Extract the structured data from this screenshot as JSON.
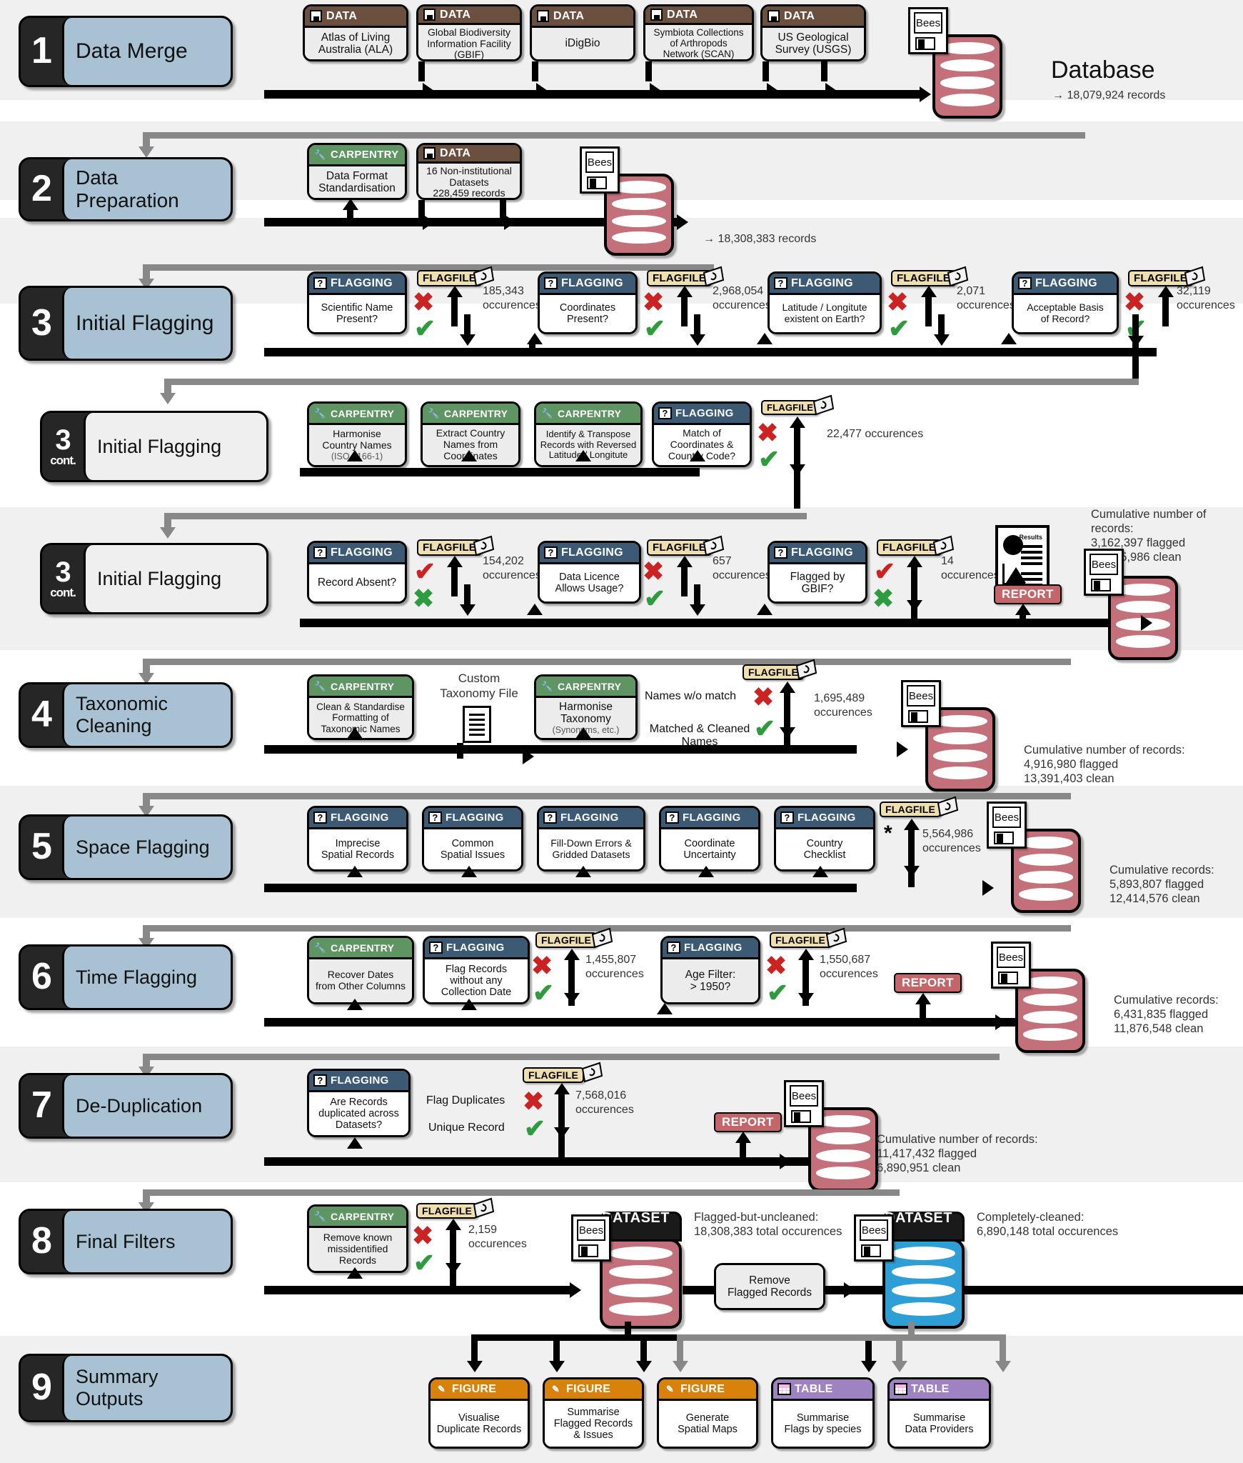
{
  "stages": [
    {
      "num": "1",
      "cont": "",
      "title": "Data Merge"
    },
    {
      "num": "2",
      "cont": "",
      "title": "Data Preparation"
    },
    {
      "num": "3",
      "cont": "",
      "title": "Initial Flagging"
    },
    {
      "num": "3",
      "cont": "cont.",
      "title": "Initial Flagging"
    },
    {
      "num": "3",
      "cont": "cont.",
      "title": "Initial Flagging"
    },
    {
      "num": "4",
      "cont": "",
      "title": "Taxonomic Cleaning"
    },
    {
      "num": "5",
      "cont": "",
      "title": "Space Flagging"
    },
    {
      "num": "6",
      "cont": "",
      "title": "Time Flagging"
    },
    {
      "num": "7",
      "cont": "",
      "title": "De-Duplication"
    },
    {
      "num": "8",
      "cont": "",
      "title": "Final Filters"
    },
    {
      "num": "9",
      "cont": "",
      "title": "Summary Outputs"
    }
  ],
  "headers": {
    "data": "DATA",
    "carpentry": "CARPENTRY",
    "flagging": "FLAGGING",
    "figure": "FIGURE",
    "table": "TABLE",
    "flagfile": "FLAGFILE",
    "report": "REPORT"
  },
  "stage1": {
    "sources": [
      {
        "head": "DATA",
        "line1": "Atlas of Living",
        "line2": "Australia (ALA)",
        "line3": ""
      },
      {
        "head": "DATA",
        "line1": "Global Biodiversity",
        "line2": "Information Facility",
        "line3": "(GBIF)"
      },
      {
        "head": "DATA",
        "line1": "iDigBio",
        "line2": "",
        "line3": ""
      },
      {
        "head": "DATA",
        "line1": "Symbiota Collections",
        "line2": "of Arthropods",
        "line3": "Network (SCAN)"
      },
      {
        "head": "DATA",
        "line1": "US Geological",
        "line2": "Survey (USGS)",
        "line3": ""
      }
    ],
    "db_label": "Bees",
    "db_title": "Database",
    "db_records": "→ 18,079,924 records"
  },
  "stage2": {
    "carpentry": {
      "line1": "Data Format",
      "line2": "Standardisation"
    },
    "data": {
      "line1": "16 Non-institutional",
      "line2": "Datasets",
      "line3": "228,459 records"
    },
    "db_label": "Bees",
    "records": "→ 18,308,383 records"
  },
  "stage3a": {
    "checks": [
      {
        "q1": "Scientific Name",
        "q2": "Present?",
        "count": "185,343",
        "unit": "occurences",
        "top": "x-red",
        "bottom": "ck-green"
      },
      {
        "q1": "Coordinates",
        "q2": "Present?",
        "count": "2,968,054",
        "unit": "occurences",
        "top": "x-red",
        "bottom": "ck-green"
      },
      {
        "q1": "Latitude / Longitute",
        "q2": "existent on Earth?",
        "count": "2,071",
        "unit": "occurences",
        "top": "x-red",
        "bottom": "ck-green"
      },
      {
        "q1": "Acceptable Basis",
        "q2": "of Record?",
        "count": "32,119",
        "unit": "occurences",
        "top": "x-red",
        "bottom": "ck-green"
      }
    ]
  },
  "stage3b": {
    "carpentry": [
      {
        "l1": "Harmonise",
        "l2": "Country Names",
        "sub": "(ISO 3166-1)"
      },
      {
        "l1": "Extract Country",
        "l2": "Names from",
        "l3": "Coordinates",
        "sub": ""
      },
      {
        "l1": "Identify & Transpose",
        "l2": "Records with Reversed",
        "l3": "Latitude / Longitute",
        "sub": ""
      }
    ],
    "flag": {
      "q1": "Match of",
      "q2": "Coordinates &",
      "q3": "Country Code?"
    },
    "count": "22,477 occurences"
  },
  "stage3c": {
    "checks": [
      {
        "q1": "Record Absent?",
        "q2": "",
        "count": "154,202",
        "unit": "occurences",
        "top": "ck-red",
        "bottom": "x-green"
      },
      {
        "q1": "Data Licence",
        "q2": "Allows Usage?",
        "count": "657",
        "unit": "occurences",
        "top": "x-red",
        "bottom": "ck-green"
      },
      {
        "q1": "Flagged by",
        "q2": "GBIF?",
        "count": "14",
        "unit": "occurences",
        "top": "ck-red",
        "bottom": "x-green"
      }
    ],
    "report_label": "REPORT",
    "results_label": "Results",
    "db_label": "Bees",
    "cumulative": [
      "Cumulative number of records:",
      "3,162,397 flagged",
      "15,145,986 clean"
    ]
  },
  "stage4": {
    "carpentry1": {
      "l1": "Clean & Standardise",
      "l2": "Formatting of",
      "l3": "Taxonomic Names"
    },
    "custom_file": {
      "l1": "Custom",
      "l2": "Taxonomy File"
    },
    "carpentry2": {
      "l1": "Harmonise",
      "l2": "Taxonomy",
      "sub": "(Synonyms, etc.)"
    },
    "branch_top": "Names w/o match",
    "branch_bottom_l1": "Matched & Cleaned",
    "branch_bottom_l2": "Names",
    "count": "1,695,489",
    "unit": "occurences",
    "db_label": "Bees",
    "cumulative": [
      "Cumulative number of records:",
      "4,916,980 flagged",
      "13,391,403 clean"
    ]
  },
  "stage5": {
    "checks": [
      {
        "l1": "Imprecise",
        "l2": "Spatial Records"
      },
      {
        "l1": "Common",
        "l2": "Spatial Issues"
      },
      {
        "l1": "Fill-Down Errors &",
        "l2": "Gridded Datasets"
      },
      {
        "l1": "Coordinate",
        "l2": "Uncertainty"
      },
      {
        "l1": "Country",
        "l2": "Checklist"
      }
    ],
    "asterisk": "*",
    "count": "5,564,986",
    "unit": "occurences",
    "db_label": "Bees",
    "cumulative": [
      "Cumulative records:",
      "5,893,807 flagged",
      "12,414,576 clean"
    ]
  },
  "stage6": {
    "carpentry": {
      "l1": "Recover Dates",
      "l2": "from Other Columns"
    },
    "flag1": {
      "l1": "Flag Records",
      "l2": "without any",
      "l3": "Collection Date",
      "count": "1,455,807",
      "unit": "occurences"
    },
    "flag2": {
      "l1": "Age Filter:",
      "l2": "> 1950?",
      "count": "1,550,687",
      "unit": "occurences"
    },
    "report_label": "REPORT",
    "db_label": "Bees",
    "cumulative": [
      "Cumulative records:",
      "6,431,835 flagged",
      "11,876,548 clean"
    ]
  },
  "stage7": {
    "flag": {
      "l1": "Are Records",
      "l2": "duplicated across",
      "l3": "Datasets?"
    },
    "branch_top": "Flag Duplicates",
    "branch_bottom": "Unique Record",
    "count": "7,568,016",
    "unit": "occurences",
    "report_label": "REPORT",
    "db_label": "Bees",
    "cumulative": [
      "Cumulative number of records:",
      "11,417,432 flagged",
      "6,890,951 clean"
    ]
  },
  "stage8": {
    "carpentry": {
      "l1": "Remove known",
      "l2": "missidentified",
      "l3": "Records"
    },
    "count": "2,159",
    "unit": "occurences",
    "dataset1": {
      "bees": "Bees",
      "name": "DATASET 1",
      "cap1": "Flagged-but-uncleaned:",
      "cap2": "18,308,383 total occurences"
    },
    "remove_box": {
      "l1": "Remove",
      "l2": "Flagged Records"
    },
    "dataset2": {
      "bees": "Bees",
      "name": "DATASET 2",
      "cap1": "Completely-cleaned:",
      "cap2": "6,890,148 total occurences"
    }
  },
  "stage9": {
    "outputs": [
      {
        "type": "FIGURE",
        "l1": "Visualise",
        "l2": "Duplicate Records"
      },
      {
        "type": "FIGURE",
        "l1": "Summarise",
        "l2": "Flagged Records",
        "l3": "& Issues"
      },
      {
        "type": "FIGURE",
        "l1": "Generate",
        "l2": "Spatial Maps"
      },
      {
        "type": "TABLE",
        "l1": "Summarise",
        "l2": "Flags by species"
      },
      {
        "type": "TABLE",
        "l1": "Summarise",
        "l2": "Data Providers"
      }
    ]
  },
  "colors": {
    "data": "#6b4f3f",
    "carpentry": "#5f9562",
    "flagging": "#3c5a73",
    "figure": "#d9820b",
    "table": "#9f82c2",
    "flagfile": "#f0dfae",
    "report": "#c4656a",
    "stage_title": "#a8c2d3",
    "db_red": "#c4707a",
    "db_blue": "#2e9fd6"
  }
}
